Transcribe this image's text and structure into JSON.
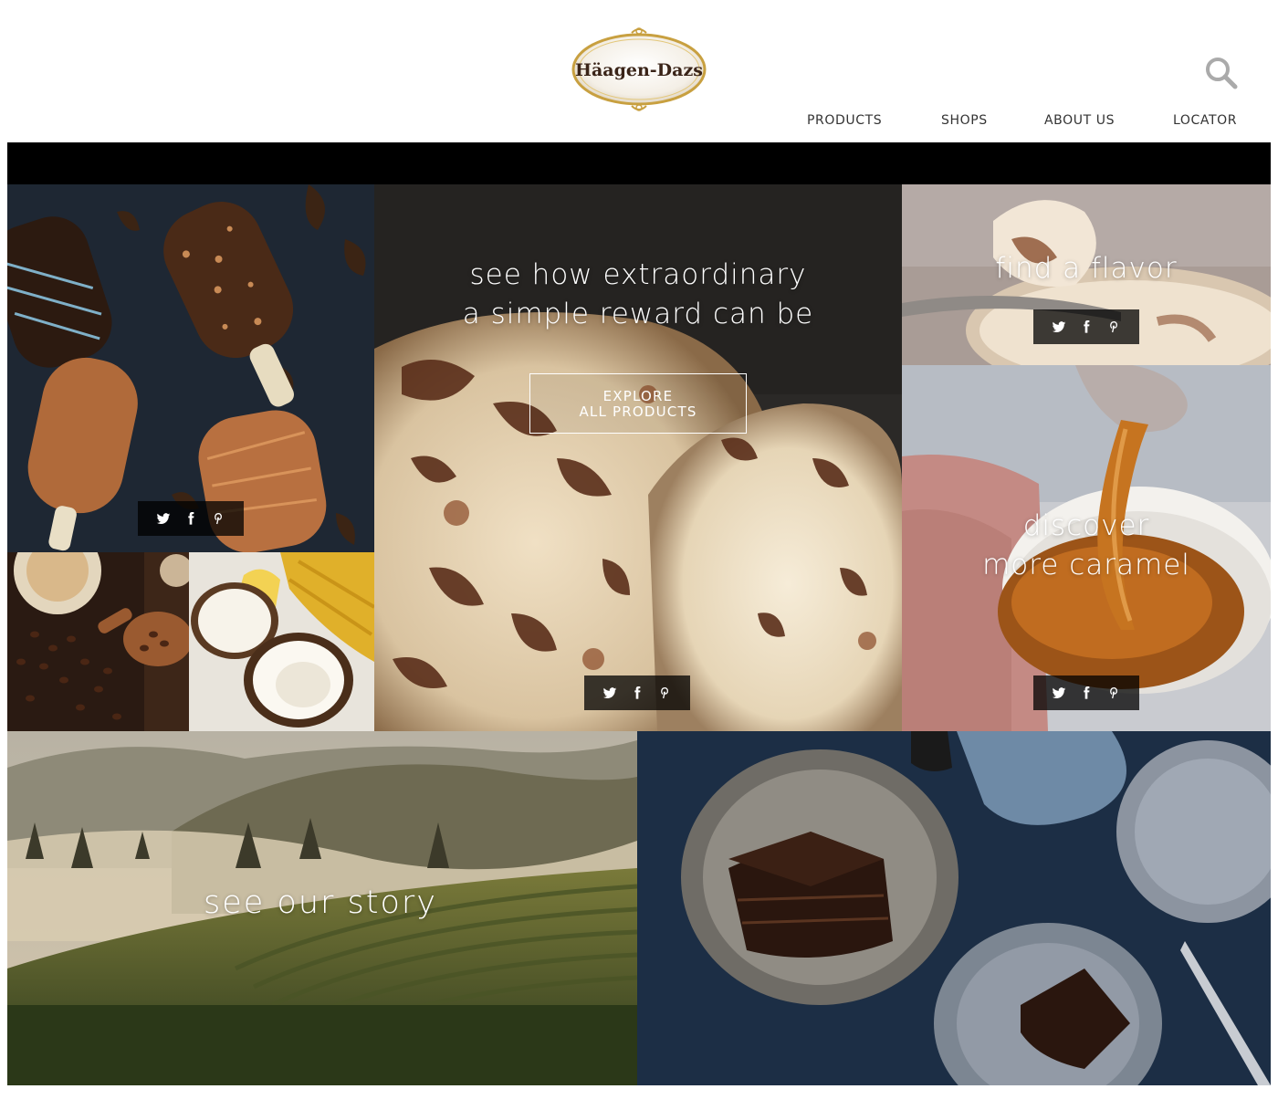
{
  "header": {
    "logo_text": "Häagen-Dazs",
    "nav": [
      {
        "label": "PRODUCTS"
      },
      {
        "label": "SHOPS"
      },
      {
        "label": "ABOUT US"
      },
      {
        "label": "LOCATOR"
      }
    ]
  },
  "hero": {
    "title_line1": "see how extraordinary",
    "title_line2": "a simple reward can be",
    "button_line1": "EXPLORE",
    "button_line2": "ALL PRODUCTS"
  },
  "flavor": {
    "title": "find a flavor"
  },
  "caramel": {
    "title_line1": "discover",
    "title_line2": "more caramel"
  },
  "story": {
    "title": "see our story"
  },
  "share_icons": [
    "twitter-icon",
    "facebook-icon",
    "pinterest-icon"
  ],
  "colors": {
    "black_bar": "#000000",
    "nav_text": "#333333",
    "logo_gold": "#c8a040",
    "logo_brown": "#3a2418"
  }
}
